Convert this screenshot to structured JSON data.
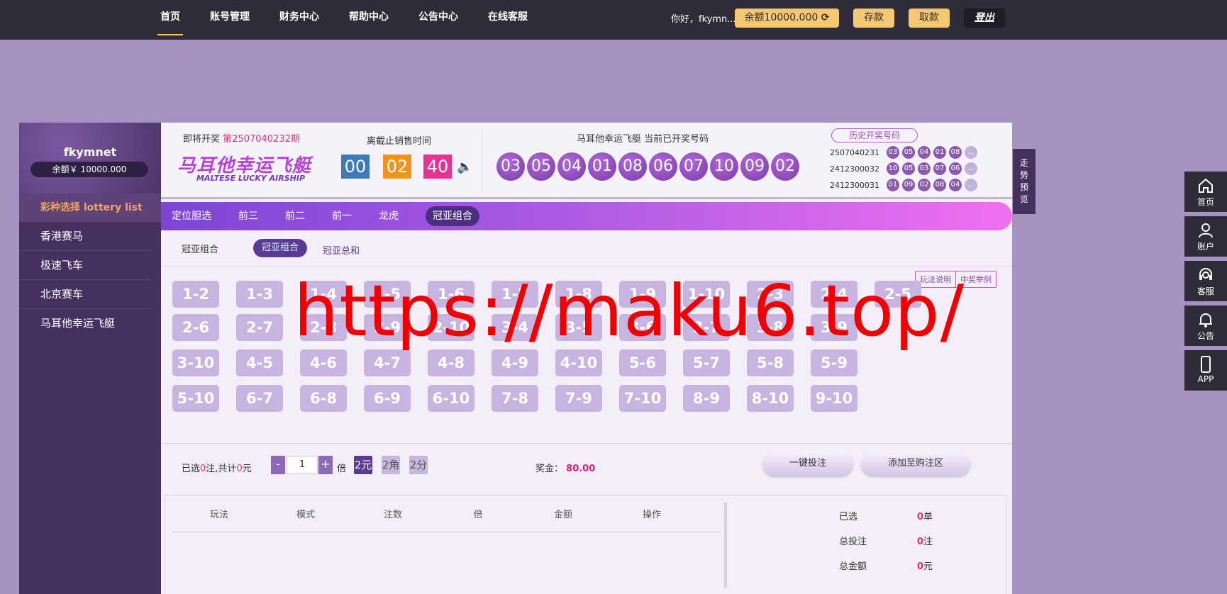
{
  "nav": {
    "items": [
      "首页",
      "账号管理",
      "财务中心",
      "帮助中心",
      "公告中心",
      "在线客服"
    ],
    "greeting": "你好，fkymn...",
    "balance_btn": "余额10000.000",
    "deposit": "存款",
    "withdraw": "取款",
    "logout": "登出"
  },
  "sidebar": {
    "username": "fkymnet",
    "balance": "余额￥ 10000.000",
    "title": "彩种选择 lottery list",
    "items": [
      "香港赛马",
      "极速飞车",
      "北京赛车",
      "马耳他幸运飞艇"
    ]
  },
  "draw": {
    "next_prefix": "即将开奖",
    "next_issue": "第2507040232期",
    "logo_cn": "马耳他幸运飞艇",
    "logo_en": "MALTESE LUCKY AIRSHIP",
    "countdown_label": "离截止销售时间",
    "countdown": [
      "00",
      "02",
      "40"
    ],
    "current_label": "马耳他幸运飞艇 当前已开奖号码",
    "current_balls": [
      "03",
      "05",
      "04",
      "01",
      "08",
      "06",
      "07",
      "10",
      "09",
      "02"
    ],
    "history_btn": "历史开奖号码",
    "history": [
      {
        "issue": "2507040231",
        "balls": [
          "03",
          "05",
          "04",
          "01",
          "08",
          "..."
        ]
      },
      {
        "issue": "2412300032",
        "balls": [
          "10",
          "05",
          "03",
          "07",
          "06",
          "..."
        ]
      },
      {
        "issue": "2412300031",
        "balls": [
          "01",
          "09",
          "02",
          "08",
          "04",
          "..."
        ]
      }
    ]
  },
  "trend_tab": [
    "走",
    "势",
    "预",
    "览"
  ],
  "tabs": [
    "定位胆选",
    "前三",
    "前二",
    "前一",
    "龙虎",
    "冠亚组合"
  ],
  "subtabs": {
    "label": "冠亚组合",
    "a": "冠亚组合",
    "b": "冠亚总和"
  },
  "help": [
    "玩法说明",
    "中奖举例"
  ],
  "picks": [
    [
      "1-2",
      "1-3",
      "1-4",
      "1-5",
      "1-6",
      "1-7",
      "1-8",
      "1-9",
      "1-10",
      "2-3",
      "2-4",
      "2-5"
    ],
    [
      "2-6",
      "2-7",
      "2-8",
      "2-9",
      "2-10",
      "3-4",
      "3-5",
      "3-6",
      "3-7",
      "3-8",
      "3-9"
    ],
    [
      "3-10",
      "4-5",
      "4-6",
      "4-7",
      "4-8",
      "4-9",
      "4-10",
      "5-6",
      "5-7",
      "5-8",
      "5-9"
    ],
    [
      "5-10",
      "6-7",
      "6-8",
      "6-9",
      "6-10",
      "7-8",
      "7-9",
      "7-10",
      "8-9",
      "8-10",
      "9-10"
    ]
  ],
  "bet": {
    "sel_a": "已选",
    "sel_count": "0",
    "sel_b": "注,共计",
    "sel_total": "0",
    "sel_c": "元",
    "minus": "-",
    "multiplier": "1",
    "plus": "+",
    "bei": "倍",
    "units": [
      "2元",
      "2角",
      "2分"
    ],
    "prize_label": "奖金：",
    "prize_value": "80.00",
    "quick": "一键投注",
    "add": "添加至购注区"
  },
  "cart": {
    "cols": [
      "玩法",
      "模式",
      "注数",
      "倍",
      "金额",
      "操作"
    ],
    "summary": [
      {
        "label": "已选",
        "value": "0",
        "unit": "单"
      },
      {
        "label": "总投注",
        "value": "0",
        "unit": "注"
      },
      {
        "label": "总金额",
        "value": "0",
        "unit": "元"
      }
    ]
  },
  "right_tools": [
    "首页",
    "账户",
    "客服",
    "公告",
    "APP"
  ],
  "watermark": "https://maku6.top/"
}
